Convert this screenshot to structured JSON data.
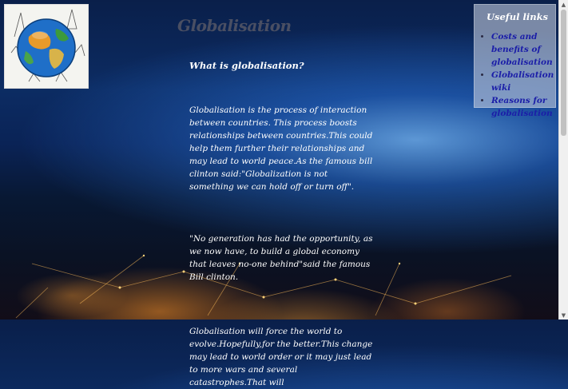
{
  "page": {
    "title": "Globalisation"
  },
  "logo": {
    "icon": "globe-with-landmarks-icon"
  },
  "main": {
    "question": "What is globalisation?",
    "paragraphs": [
      "Globalisation is the process of interaction between countries. This process boosts relationships between countries.This could help them further their relationships and may lead to world peace.As the famous bill clinton said:\"Globalization is not something we can hold off or turn off\".",
      "\"No generation has had the opportunity, as we now have, to build a global economy that leaves no-one behind\"said the famous Bill clinton.",
      "Globalisation will force the world to evolve.Hopefully,for the better.This change may lead to world order or it may just lead to more wars and several catastrophes.That will"
    ]
  },
  "sidebar": {
    "heading": "Useful links",
    "links": [
      {
        "label": "Costs and benefits of globalisation"
      },
      {
        "label": "Globalisation wiki"
      },
      {
        "label": "Reasons for globalisation"
      }
    ]
  },
  "colors": {
    "title": "#4a4f63",
    "link": "#1b1ea8",
    "text": "#ffffff"
  }
}
